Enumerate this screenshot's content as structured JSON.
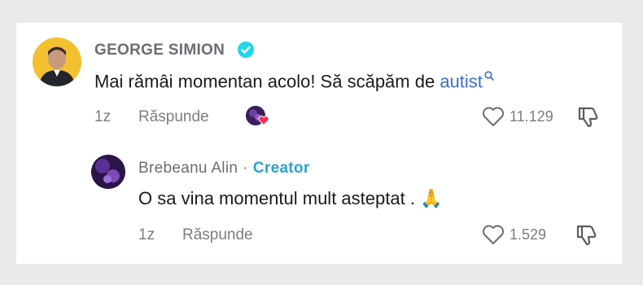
{
  "comment": {
    "author": "GEORGE SIMION",
    "text_before": "Mai rămâi momentan acolo! Să scăpăm de ",
    "mention": "autist",
    "time": "1z",
    "reply_label": "Răspunde",
    "likes": "11.129",
    "verified_color": "#20d5ec"
  },
  "reply": {
    "author": "Brebeanu Alin",
    "separator": "·",
    "badge": "Creator",
    "text": "O sa vina momentul mult asteptat . 🙏",
    "time": "1z",
    "reply_label": "Răspunde",
    "likes": "1.529"
  },
  "icons": {
    "verified": "verified-badge-icon",
    "search": "search-icon",
    "like": "heart-icon",
    "dislike": "thumbs-down-icon",
    "liked_by_creator": "heart-badge-icon"
  }
}
